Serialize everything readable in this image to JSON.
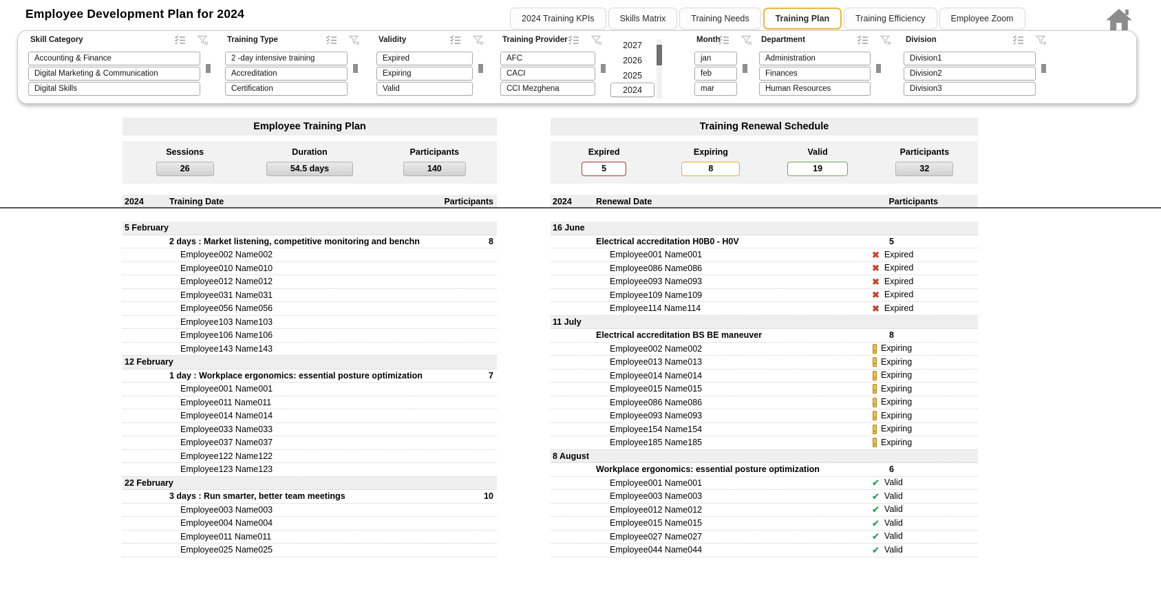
{
  "title": "Employee Development Plan for 2024",
  "tabs": [
    {
      "label": "2024 Training KPIs",
      "active": false
    },
    {
      "label": "Skills Matrix",
      "active": false
    },
    {
      "label": "Training Needs",
      "active": false
    },
    {
      "label": "Training Plan",
      "active": true
    },
    {
      "label": "Training Efficiency",
      "active": false
    },
    {
      "label": "Employee Zoom",
      "active": false
    }
  ],
  "slicers": [
    {
      "title": "Skill Category",
      "items": [
        "Accounting & Finance",
        "Digital Marketing & Communication",
        "Digital Skills"
      ]
    },
    {
      "title": "Training Type",
      "items": [
        "2 -day intensive training",
        "Accreditation",
        "Certification"
      ]
    },
    {
      "title": "Validity",
      "items": [
        "Expired",
        "Expiring",
        "Valid"
      ]
    },
    {
      "title": "Training Provider",
      "items": [
        "AFC",
        "CACI",
        "CCI Mezghena"
      ]
    },
    {
      "title": "Month",
      "items": [
        "jan",
        "feb",
        "mar"
      ]
    },
    {
      "title": "Department",
      "items": [
        "Administration",
        "Finances",
        "Human Resources"
      ]
    },
    {
      "title": "Division",
      "items": [
        "Division1",
        "Division2",
        "Division3"
      ]
    }
  ],
  "year_slicer": {
    "items": [
      "2027",
      "2026",
      "2025",
      "2024"
    ],
    "selected": "2024"
  },
  "left_panel": {
    "title": "Employee Training Plan",
    "kpis": [
      {
        "label": "Sessions",
        "value": "26",
        "style": "plain"
      },
      {
        "label": "Duration",
        "value": "54.5 days",
        "style": "plain"
      },
      {
        "label": "Participants",
        "value": "140",
        "style": "plain"
      }
    ],
    "table": {
      "year": "2024",
      "date_col": "Training Date",
      "participants_col": "Participants",
      "groups": [
        {
          "date": "5 February",
          "session": "2 days : Market listening, competitive monitoring and benchn",
          "participants": "8",
          "employees": [
            "Employee002 Name002",
            "Employee010 Name010",
            "Employee012 Name012",
            "Employee031 Name031",
            "Employee056 Name056",
            "Employee103 Name103",
            "Employee106 Name106",
            "Employee143 Name143"
          ]
        },
        {
          "date": "12 February",
          "session": "1 day : Workplace ergonomics: essential posture optimization",
          "participants": "7",
          "employees": [
            "Employee001 Name001",
            "Employee011 Name011",
            "Employee014 Name014",
            "Employee033 Name033",
            "Employee037 Name037",
            "Employee122 Name122",
            "Employee123 Name123"
          ]
        },
        {
          "date": "22 February",
          "session": "3 days : Run smarter, better team meetings",
          "participants": "10",
          "employees": [
            "Employee003 Name003",
            "Employee004 Name004",
            "Employee011 Name011",
            "Employee025 Name025"
          ]
        }
      ]
    }
  },
  "right_panel": {
    "title": "Training Renewal Schedule",
    "kpis": [
      {
        "label": "Expired",
        "value": "5",
        "style": "expired"
      },
      {
        "label": "Expiring",
        "value": "8",
        "style": "expiring"
      },
      {
        "label": "Valid",
        "value": "19",
        "style": "valid"
      },
      {
        "label": "Participants",
        "value": "32",
        "style": "plain"
      }
    ],
    "table": {
      "year": "2024",
      "date_col": "Renewal Date",
      "participants_col": "Participants",
      "groups": [
        {
          "date": "16 June",
          "session": "Electrical accreditation H0B0 - H0V",
          "participants": "5",
          "status": "Expired",
          "employees": [
            "Employee001 Name001",
            "Employee086 Name086",
            "Employee093 Name093",
            "Employee109 Name109",
            "Employee114 Name114"
          ]
        },
        {
          "date": "11 July",
          "session": "Electrical accreditation BS BE maneuver",
          "participants": "8",
          "status": "Expiring",
          "employees": [
            "Employee002 Name002",
            "Employee013 Name013",
            "Employee014 Name014",
            "Employee015 Name015",
            "Employee086 Name086",
            "Employee093 Name093",
            "Employee154 Name154",
            "Employee185 Name185"
          ]
        },
        {
          "date": "8 August",
          "session": "Workplace ergonomics: essential posture optimization",
          "participants": "6",
          "status": "Valid",
          "employees": [
            "Employee001 Name001",
            "Employee003 Name003",
            "Employee012 Name012",
            "Employee015 Name015",
            "Employee027 Name027",
            "Employee044 Name044"
          ]
        }
      ]
    }
  },
  "colors": {
    "accent": "#e9b63b",
    "expired_border": "#a33c30",
    "expiring_border": "#e4ae36",
    "valid_border": "#71a858",
    "expired_icon": "#c2452d",
    "expiring_icon": "#edc24a",
    "valid_icon": "#3f9e63",
    "header_bg": "#efefef"
  }
}
